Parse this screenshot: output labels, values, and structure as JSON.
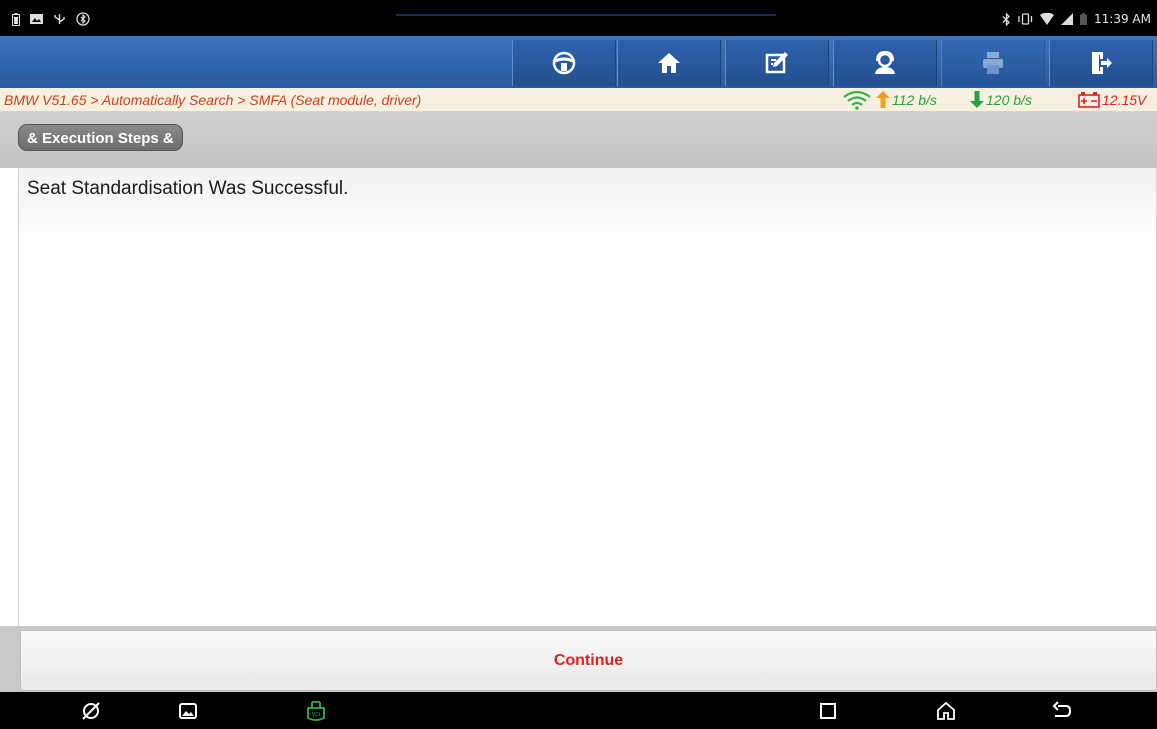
{
  "statusbar": {
    "time": "11:39 AM"
  },
  "toolbar": {
    "buttons": [
      {
        "name": "diagnose",
        "icon": "steering-wheel-icon"
      },
      {
        "name": "home",
        "icon": "home-icon"
      },
      {
        "name": "report",
        "icon": "edit-report-icon"
      },
      {
        "name": "feedback",
        "icon": "support-agent-icon"
      },
      {
        "name": "print",
        "icon": "printer-icon"
      },
      {
        "name": "exit",
        "icon": "exit-door-icon"
      }
    ]
  },
  "breadcrumb": {
    "path": "BMW V51.65 > Automatically Search > SMFA (Seat module, driver)"
  },
  "network": {
    "upload": "112 b/s",
    "download": "120 b/s",
    "voltage": "12.15V"
  },
  "section": {
    "title": "& Execution Steps &"
  },
  "content": {
    "message": "Seat Standardisation Was Successful."
  },
  "footer": {
    "continue_label": "Continue"
  },
  "colors": {
    "toolbar": "#2f64ad",
    "crumb_text": "#d23b1a",
    "continue_text": "#e0201c",
    "network_text": "#2a9f3c",
    "upload_arrow": "#f0a020"
  }
}
